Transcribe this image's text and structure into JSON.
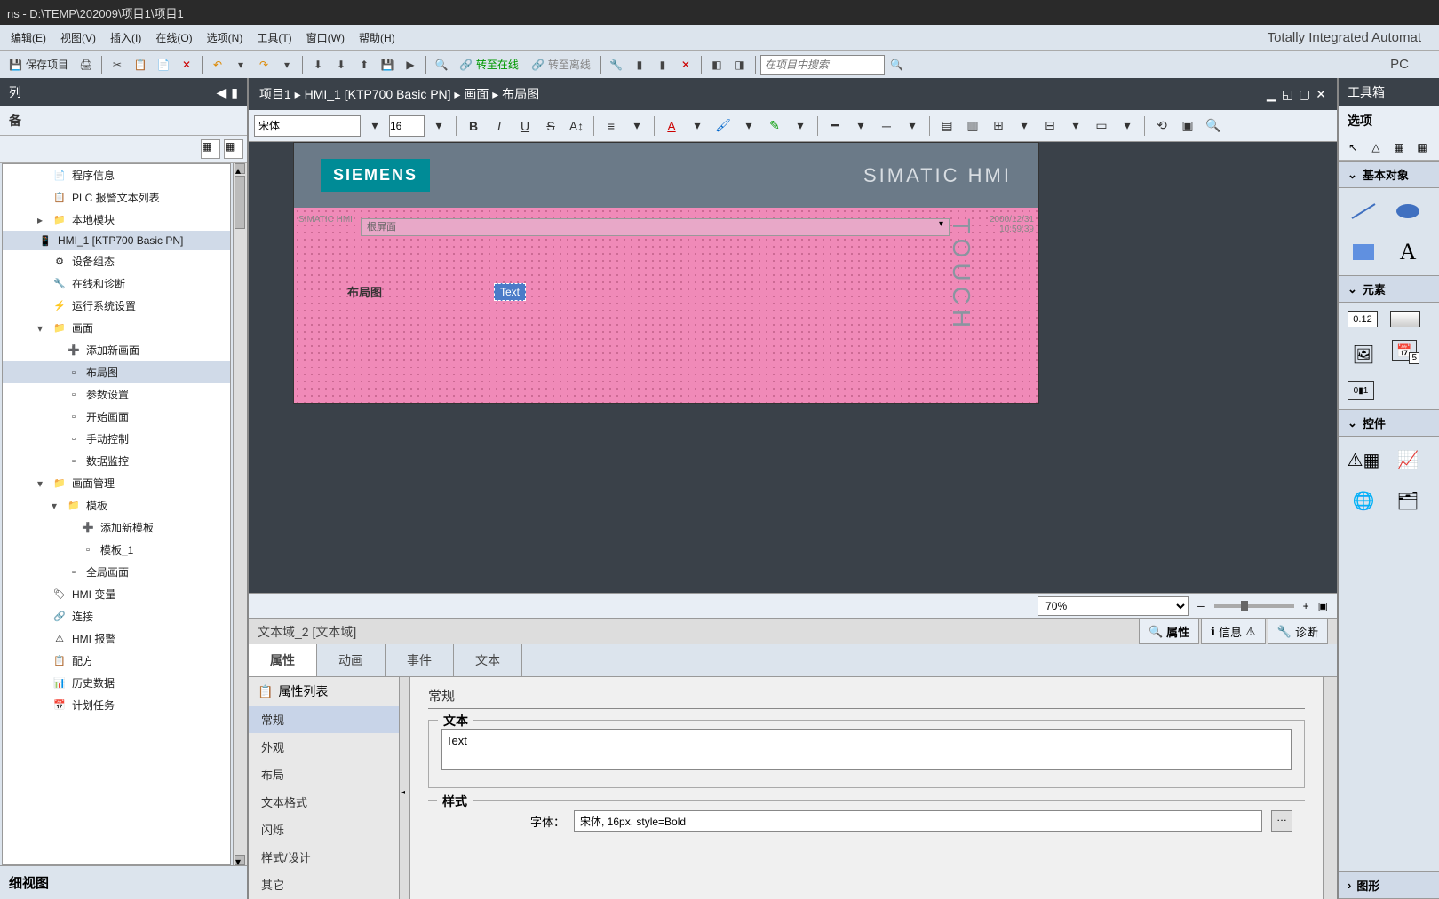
{
  "window": {
    "title_prefix": "ns",
    "title_sep": "  -  ",
    "path": "D:\\TEMP\\202009\\项目1\\项目1"
  },
  "menu": {
    "items": [
      "编辑(E)",
      "视图(V)",
      "插入(I)",
      "在线(O)",
      "选项(N)",
      "工具(T)",
      "窗口(W)",
      "帮助(H)"
    ],
    "brand": "Totally Integrated Automat",
    "brand2": "PC"
  },
  "toolbar": {
    "save": "保存项目",
    "go_online": "转至在线",
    "go_offline": "转至离线",
    "search_placeholder": "在项目中搜索"
  },
  "project_tree": {
    "title": "列",
    "sub": "备",
    "items": [
      {
        "lvl": 1,
        "icon": "📄",
        "label": "程序信息"
      },
      {
        "lvl": 1,
        "icon": "📋",
        "label": "PLC 报警文本列表"
      },
      {
        "lvl": 1,
        "icon": "📁",
        "label": "本地模块",
        "exp": "▸"
      },
      {
        "lvl": 0,
        "icon": "📱",
        "label": "HMI_1 [KTP700 Basic PN]",
        "selected": true
      },
      {
        "lvl": 1,
        "icon": "⚙",
        "label": "设备组态"
      },
      {
        "lvl": 1,
        "icon": "🔧",
        "label": "在线和诊断"
      },
      {
        "lvl": 1,
        "icon": "⚡",
        "label": "运行系统设置"
      },
      {
        "lvl": 1,
        "icon": "📁",
        "label": "画面",
        "exp": "▾"
      },
      {
        "lvl": 2,
        "icon": "➕",
        "label": "添加新画面"
      },
      {
        "lvl": 2,
        "icon": "▫",
        "label": "布局图",
        "selected": true
      },
      {
        "lvl": 2,
        "icon": "▫",
        "label": "参数设置"
      },
      {
        "lvl": 2,
        "icon": "▫",
        "label": "开始画面"
      },
      {
        "lvl": 2,
        "icon": "▫",
        "label": "手动控制"
      },
      {
        "lvl": 2,
        "icon": "▫",
        "label": "数据监控"
      },
      {
        "lvl": 1,
        "icon": "📁",
        "label": "画面管理",
        "exp": "▾"
      },
      {
        "lvl": 2,
        "icon": "📁",
        "label": "模板",
        "exp": "▾"
      },
      {
        "lvl": 3,
        "icon": "➕",
        "label": "添加新模板"
      },
      {
        "lvl": 3,
        "icon": "▫",
        "label": "模板_1"
      },
      {
        "lvl": 2,
        "icon": "▫",
        "label": "全局画面"
      },
      {
        "lvl": 1,
        "icon": "🏷",
        "label": "HMI 变量"
      },
      {
        "lvl": 1,
        "icon": "🔗",
        "label": "连接"
      },
      {
        "lvl": 1,
        "icon": "⚠",
        "label": "HMI 报警"
      },
      {
        "lvl": 1,
        "icon": "📋",
        "label": "配方"
      },
      {
        "lvl": 1,
        "icon": "📊",
        "label": "历史数据"
      },
      {
        "lvl": 1,
        "icon": "📅",
        "label": "计划任务"
      }
    ],
    "detail": "细视图"
  },
  "breadcrumb": {
    "path": "项目1  ▸  HMI_1 [KTP700 Basic PN]  ▸  画面  ▸  布局图"
  },
  "editor": {
    "font": "宋体",
    "size": "16",
    "siemens": "SIEMENS",
    "simatic": "SIMATIC HMI",
    "touch": "TOUCH",
    "label1": "布局图",
    "textobj": "Text",
    "topbar_ph": "根屏面",
    "toptime1": "2000/12/31",
    "toptime2": "10:59:39",
    "zoom": "70%"
  },
  "props": {
    "header_title": "文本域_2 [文本域]",
    "tab_props": "属性",
    "tab_info": "信息",
    "tab_diag": "诊断",
    "tabs": [
      "属性",
      "动画",
      "事件",
      "文本"
    ],
    "list_head": "属性列表",
    "list": [
      "常规",
      "外观",
      "布局",
      "文本格式",
      "闪烁",
      "样式/设计",
      "其它"
    ],
    "group_general": "常规",
    "fieldset_text": "文本",
    "text_value": "Text",
    "fieldset_style": "样式",
    "font_label": "字体：",
    "font_value": "宋体, 16px, style=Bold"
  },
  "toolbox": {
    "title": "工具箱",
    "options": "选项",
    "sec_basic": "基本对象",
    "sec_elem": "元素",
    "sec_ctrl": "控件",
    "sec_graph": "图形",
    "elem_012": "0.12"
  }
}
